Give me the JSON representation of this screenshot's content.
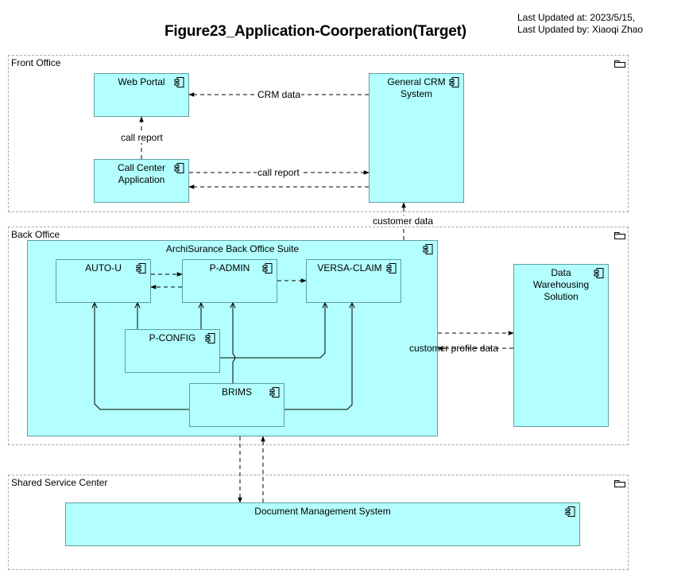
{
  "header": {
    "title": "Figure23_Application-Coorperation(Target)",
    "last_updated_at": "Last Updated at: 2023/5/15,",
    "last_updated_by": "Last Updated by: Xiaoqi Zhao"
  },
  "groups": {
    "front_office": {
      "label": "Front Office",
      "icon": "package-icon"
    },
    "back_office": {
      "label": "Back Office",
      "icon": "package-icon"
    },
    "shared_service_center": {
      "label": "Shared Service Center",
      "icon": "package-icon"
    }
  },
  "components": {
    "web_portal": {
      "label": "Web Portal",
      "icon": "component-icon"
    },
    "call_center": {
      "label": "Call Center Application",
      "icon": "component-icon"
    },
    "general_crm": {
      "label": "General CRM System",
      "icon": "component-icon"
    },
    "back_office_suite": {
      "label": "ArchiSurance Back Office Suite",
      "icon": "component-icon"
    },
    "auto_u": {
      "label": "AUTO-U",
      "icon": "component-icon"
    },
    "p_admin": {
      "label": "P-ADMIN",
      "icon": "component-icon"
    },
    "versa_claim": {
      "label": "VERSA-CLAIM",
      "icon": "component-icon"
    },
    "p_config": {
      "label": "P-CONFIG",
      "icon": "component-icon"
    },
    "brims": {
      "label": "BRIMS",
      "icon": "component-icon"
    },
    "data_warehousing": {
      "label": "Data Warehousing Solution",
      "icon": "component-icon"
    },
    "document_management": {
      "label": "Document Management System",
      "icon": "component-icon"
    }
  },
  "relations": {
    "crm_data": "CRM data",
    "call_report_vertical": "call report",
    "call_report_horizontal": "call report",
    "customer_data": "customer data",
    "customer_profile_data": "customer profile data"
  },
  "colors": {
    "component_fill": "#b3ffff",
    "component_border": "#5f9ea0",
    "group_border": "#a8a8a8"
  }
}
